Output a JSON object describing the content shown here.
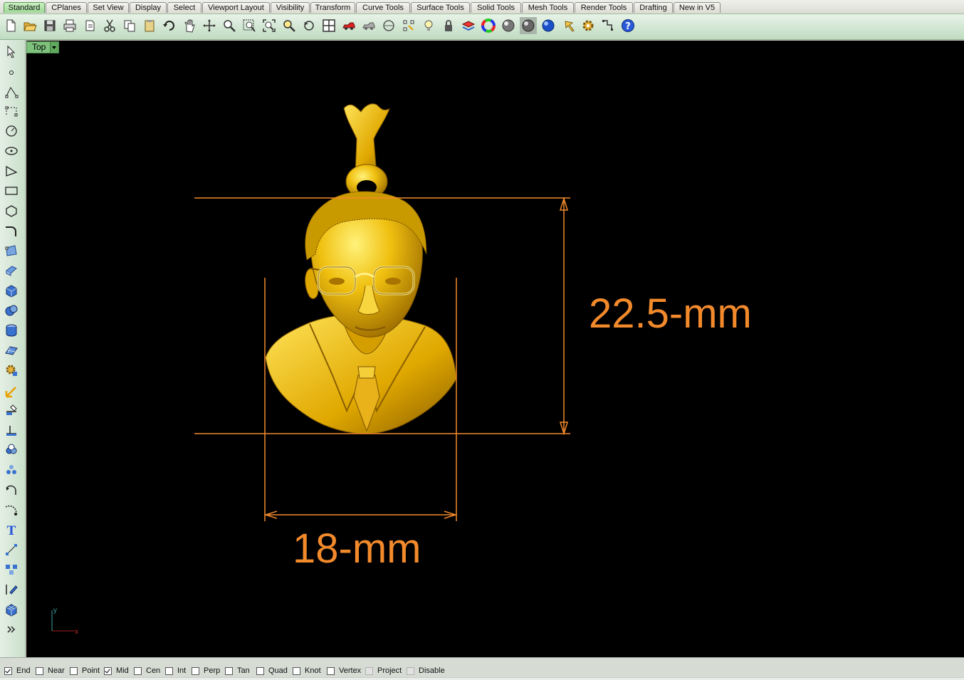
{
  "tabs": [
    {
      "label": "Standard",
      "active": true
    },
    {
      "label": "CPlanes"
    },
    {
      "label": "Set View"
    },
    {
      "label": "Display"
    },
    {
      "label": "Select"
    },
    {
      "label": "Viewport Layout"
    },
    {
      "label": "Visibility"
    },
    {
      "label": "Transform"
    },
    {
      "label": "Curve Tools"
    },
    {
      "label": "Surface Tools"
    },
    {
      "label": "Solid Tools"
    },
    {
      "label": "Mesh Tools"
    },
    {
      "label": "Render Tools"
    },
    {
      "label": "Drafting"
    },
    {
      "label": "New in V5"
    }
  ],
  "toolbar_icons": [
    "new-icon",
    "open-icon",
    "save-icon",
    "print-icon",
    "import-icon",
    "cut-icon",
    "copy-icon",
    "paste-icon",
    "undo-icon",
    "pan-icon",
    "rotate-view-icon",
    "zoom-icon",
    "zoom-window-icon",
    "zoom-extents-icon",
    "zoom-selected-icon",
    "undo-view-icon",
    "four-viewports-icon",
    "car-icon",
    "hide-icon",
    "show-icon",
    "select-points-icon",
    "light-icon",
    "lock-icon",
    "layer-icon",
    "color-wheel-icon",
    "shaded-sphere-icon",
    "rendered-sphere-icon",
    "render-sphere-icon",
    "properties-icon",
    "options-gear-icon",
    "grid-snap-icon",
    "help-icon"
  ],
  "left_icons": [
    "select-arrow-icon",
    "point-icon",
    "polyline-icon",
    "curve-icon",
    "circle-icon",
    "ellipse-icon",
    "arc-icon",
    "rectangle-icon",
    "polygon-icon",
    "fillet-curve-icon",
    "surface-from-points-icon",
    "extrude-surface-icon",
    "box-icon",
    "boolean-icon",
    "cylinder-icon",
    "surface-icon",
    "solid-tools-gear-icon",
    "transform-icon",
    "split-icon",
    "trim-icon",
    "group-icon",
    "array-icon",
    "rotate-icon",
    "fillet-icon",
    "text-icon",
    "point-cloud-icon",
    "block-icon",
    "analyze-icon",
    "mesh-box-icon",
    "more-icon"
  ],
  "viewport": {
    "title": "Top",
    "dimensions": {
      "height_label": "22.5-mm",
      "width_label": "18-mm"
    },
    "axis": {
      "x": "x",
      "y": "y"
    }
  },
  "colors": {
    "dimension": "#f28a2c",
    "model": "#e8b400",
    "accent_tab": "#9ed896"
  },
  "osnaps": [
    {
      "label": "End",
      "checked": true
    },
    {
      "label": "Near",
      "checked": false
    },
    {
      "label": "Point",
      "checked": false
    },
    {
      "label": "Mid",
      "checked": true
    },
    {
      "label": "Cen",
      "checked": false
    },
    {
      "label": "Int",
      "checked": false
    },
    {
      "label": "Perp",
      "checked": false
    },
    {
      "label": "Tan",
      "checked": false
    },
    {
      "label": "Quad",
      "checked": false
    },
    {
      "label": "Knot",
      "checked": false
    },
    {
      "label": "Vertex",
      "checked": false
    },
    {
      "label": "Project",
      "checked": false,
      "disabled": true
    },
    {
      "label": "Disable",
      "checked": false,
      "disabled": true
    }
  ]
}
